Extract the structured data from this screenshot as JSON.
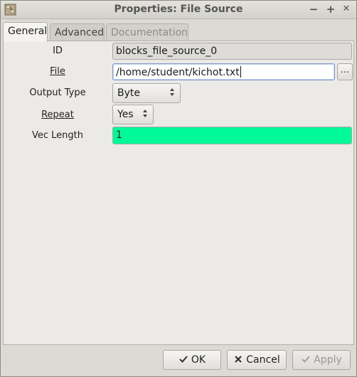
{
  "window": {
    "title": "Properties: File Source"
  },
  "wm": {
    "minimize": "−",
    "maximize": "+",
    "close": "✕"
  },
  "tabs": [
    {
      "label": "General",
      "state": "active"
    },
    {
      "label": "Advanced",
      "state": "normal"
    },
    {
      "label": "Documentation",
      "state": "disabled"
    }
  ],
  "fields": {
    "id": {
      "label": "ID",
      "value": "blocks_file_source_0"
    },
    "file": {
      "label": "File",
      "value": "/home/student/kichot.txt",
      "browse": "..."
    },
    "output_type": {
      "label": "Output Type",
      "value": "Byte"
    },
    "repeat": {
      "label": "Repeat",
      "value": "Yes"
    },
    "vec_length": {
      "label": "Vec Length",
      "value": "1"
    }
  },
  "buttons": {
    "ok": "OK",
    "cancel": "Cancel",
    "apply": "Apply"
  },
  "colors": {
    "vec_length_bg": "#00fa9a",
    "accent_focus": "#7f9ac9"
  }
}
